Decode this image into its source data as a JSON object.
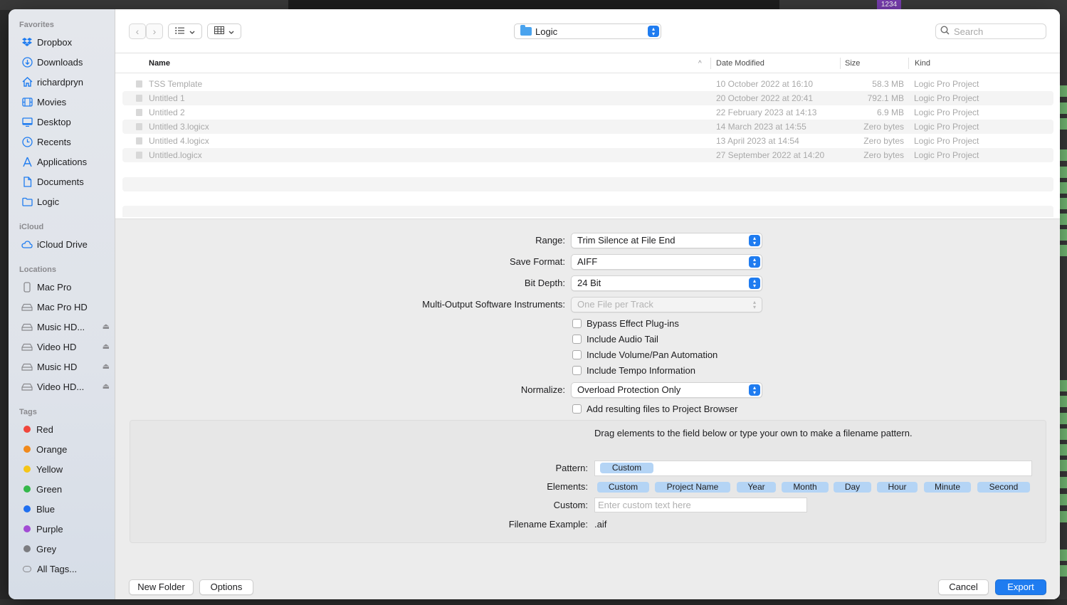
{
  "background_app": {
    "badge": "1234"
  },
  "sidebar": {
    "favorites_label": "Favorites",
    "favorites": [
      {
        "label": "Dropbox",
        "icon": "dropbox-icon"
      },
      {
        "label": "Downloads",
        "icon": "downloads-icon"
      },
      {
        "label": "richardpryn",
        "icon": "home-icon"
      },
      {
        "label": "Movies",
        "icon": "movies-icon"
      },
      {
        "label": "Desktop",
        "icon": "desktop-icon"
      },
      {
        "label": "Recents",
        "icon": "clock-icon"
      },
      {
        "label": "Applications",
        "icon": "applications-icon"
      },
      {
        "label": "Documents",
        "icon": "document-icon"
      },
      {
        "label": "Logic",
        "icon": "folder-icon"
      }
    ],
    "icloud_label": "iCloud",
    "icloud": [
      {
        "label": "iCloud Drive",
        "icon": "cloud-icon"
      }
    ],
    "locations_label": "Locations",
    "locations": [
      {
        "label": "Mac Pro",
        "icon": "computer-icon",
        "eject": false
      },
      {
        "label": "Mac Pro HD",
        "icon": "disk-icon",
        "eject": false
      },
      {
        "label": "Music HD...",
        "icon": "disk-icon",
        "eject": true
      },
      {
        "label": "Video HD",
        "icon": "disk-icon",
        "eject": true
      },
      {
        "label": "Music HD",
        "icon": "disk-icon",
        "eject": true
      },
      {
        "label": "Video HD...",
        "icon": "disk-icon",
        "eject": true
      }
    ],
    "tags_label": "Tags",
    "tags": [
      {
        "label": "Red",
        "color": "#f0463c"
      },
      {
        "label": "Orange",
        "color": "#f08a1c"
      },
      {
        "label": "Yellow",
        "color": "#f5c518"
      },
      {
        "label": "Green",
        "color": "#34b84a"
      },
      {
        "label": "Blue",
        "color": "#1f6ff0"
      },
      {
        "label": "Purple",
        "color": "#a24bd4"
      },
      {
        "label": "Grey",
        "color": "#7c7c80"
      },
      {
        "label": "All Tags...",
        "color": null
      }
    ]
  },
  "toolbar": {
    "back": "‹",
    "forward": "›",
    "location": "Logic",
    "search_placeholder": "Search"
  },
  "table": {
    "columns": {
      "name": "Name",
      "date": "Date Modified",
      "size": "Size",
      "kind": "Kind"
    },
    "rows": [
      {
        "name": "TSS Template",
        "date": "10 October 2022 at 16:10",
        "size": "58.3 MB",
        "kind": "Logic Pro Project"
      },
      {
        "name": "Untitled 1",
        "date": "20 October 2022 at 20:41",
        "size": "792.1 MB",
        "kind": "Logic Pro Project"
      },
      {
        "name": "Untitled 2",
        "date": "22 February 2023 at 14:13",
        "size": "6.9 MB",
        "kind": "Logic Pro Project"
      },
      {
        "name": "Untitled 3.logicx",
        "date": "14 March 2023 at 14:55",
        "size": "Zero bytes",
        "kind": "Logic Pro Project"
      },
      {
        "name": "Untitled 4.logicx",
        "date": "13 April 2023 at 14:54",
        "size": "Zero bytes",
        "kind": "Logic Pro Project"
      },
      {
        "name": "Untitled.logicx",
        "date": "27 September 2022 at 14:20",
        "size": "Zero bytes",
        "kind": "Logic Pro Project"
      }
    ]
  },
  "options": {
    "range_label": "Range:",
    "range_value": "Trim Silence at File End",
    "format_label": "Save Format:",
    "format_value": "AIFF",
    "bitdepth_label": "Bit Depth:",
    "bitdepth_value": "24 Bit",
    "multi_label": "Multi-Output Software Instruments:",
    "multi_value": "One File per Track",
    "checks": [
      "Bypass Effect Plug-ins",
      "Include Audio Tail",
      "Include Volume/Pan Automation",
      "Include Tempo Information"
    ],
    "normalize_label": "Normalize:",
    "normalize_value": "Overload Protection Only",
    "add_to_browser": "Add resulting files to Project Browser"
  },
  "pattern": {
    "hint": "Drag elements to the field below or type your own to make a filename pattern.",
    "pattern_label": "Pattern:",
    "pattern_tokens": [
      "Custom"
    ],
    "elements_label": "Elements:",
    "elements": [
      "Custom",
      "Project Name",
      "Year",
      "Month",
      "Day",
      "Hour",
      "Minute",
      "Second"
    ],
    "custom_label": "Custom:",
    "custom_placeholder": "Enter custom text here",
    "example_label": "Filename Example:",
    "example_value": ".aif"
  },
  "buttons": {
    "new_folder": "New Folder",
    "options": "Options",
    "cancel": "Cancel",
    "export": "Export"
  },
  "colors": {
    "accent": "#1f7cf0",
    "token": "#b4d4f5"
  }
}
